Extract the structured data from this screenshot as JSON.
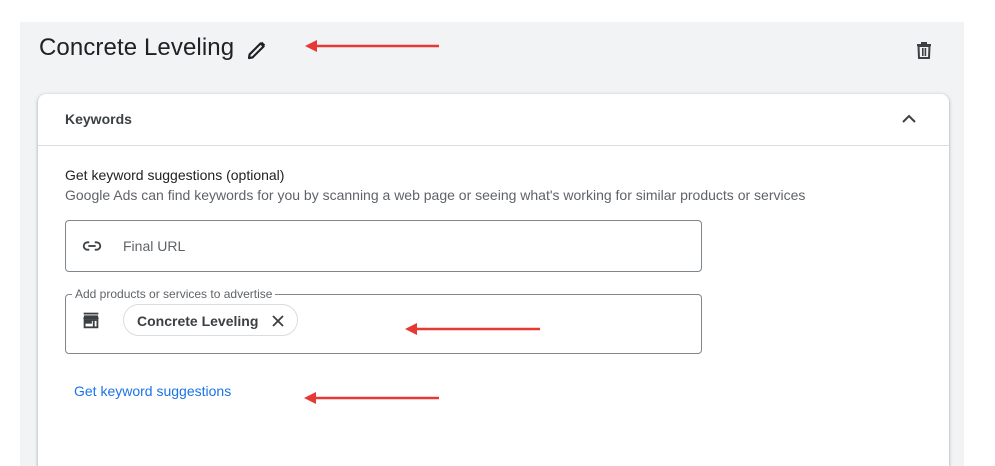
{
  "ad_group": {
    "title": "Concrete Leveling",
    "edit_icon": "pencil-icon",
    "delete_icon": "trash-icon"
  },
  "keywords_card": {
    "title": "Keywords",
    "collapse_icon": "chevron-up-icon",
    "suggestions_title": "Get keyword suggestions (optional)",
    "suggestions_desc": "Google Ads can find keywords for you by scanning a web page or seeing what's working for similar products or services",
    "final_url": {
      "icon": "link-icon",
      "placeholder": "Final URL",
      "value": ""
    },
    "products": {
      "icon": "storefront-icon",
      "legend": "Add products or services to advertise",
      "chips": [
        {
          "label": "Concrete Leveling",
          "close_icon": "close-icon"
        }
      ]
    },
    "get_suggestions_link": "Get keyword suggestions"
  },
  "annotations": {
    "arrow_color": "#e53935"
  },
  "colors": {
    "link": "#1a73e8",
    "background": "#f1f3f4",
    "border": "#80868b"
  }
}
